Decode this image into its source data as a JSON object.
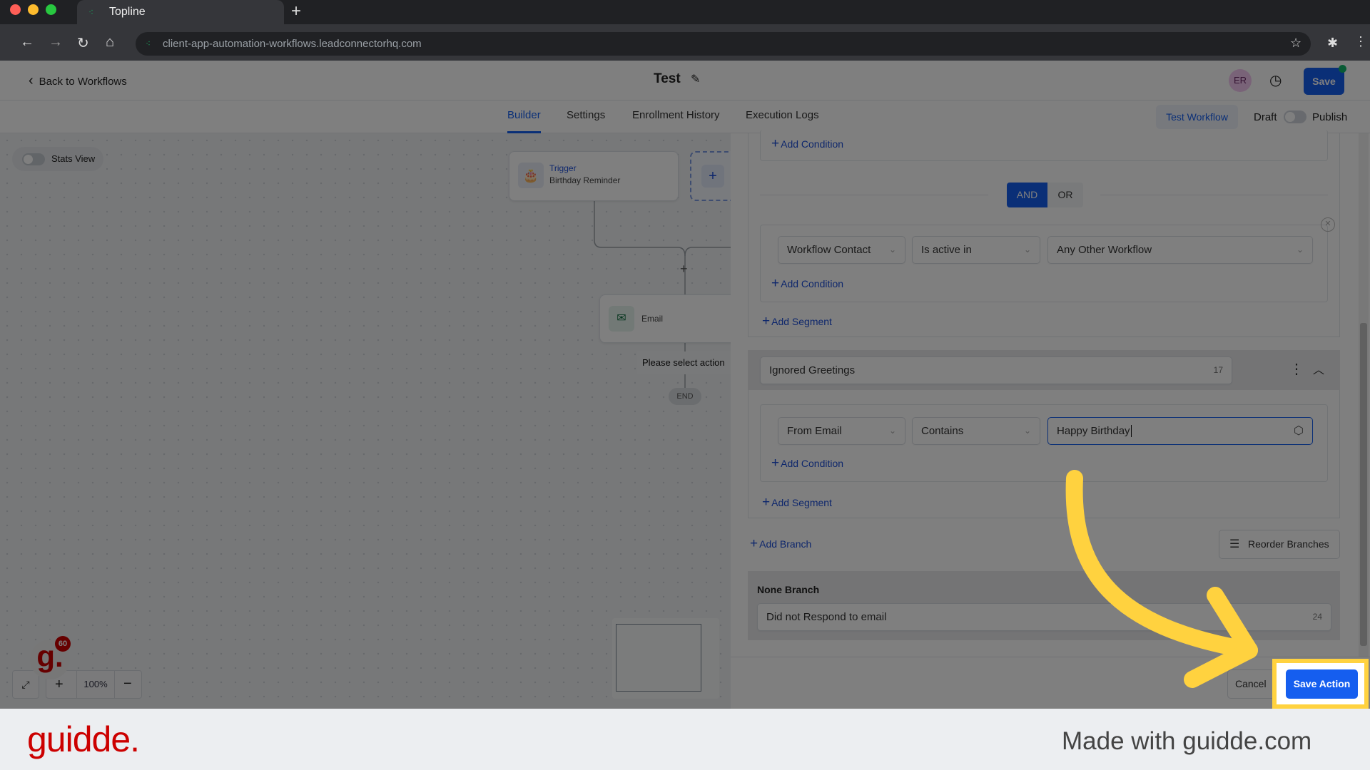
{
  "browser": {
    "tab_title": "Topline",
    "url": "client-app-automation-workflows.leadconnectorhq.com"
  },
  "header": {
    "back_label": "Back to Workflows",
    "title": "Test",
    "avatar_initials": "ER",
    "save_label": "Save"
  },
  "tabs": [
    {
      "label": "Builder",
      "active": true
    },
    {
      "label": "Settings"
    },
    {
      "label": "Enrollment History"
    },
    {
      "label": "Execution Logs"
    }
  ],
  "toolbar": {
    "test_workflow_label": "Test Workflow",
    "draft_label": "Draft",
    "publish_label": "Publish",
    "published": false
  },
  "canvas": {
    "stats_view_label": "Stats View",
    "stats_view_on": false,
    "trigger": {
      "label": "Trigger",
      "name": "Birthday Reminder"
    },
    "email_node": {
      "label": "Email"
    },
    "tooltip": "Please select action",
    "end_label": "END",
    "zoom_level": "100%"
  },
  "panel": {
    "add_condition": "Add Condition",
    "add_segment": "Add Segment",
    "logic": {
      "and": "AND",
      "or": "OR",
      "selected": "AND"
    },
    "segment1": {
      "field": "Workflow Contact",
      "operator": "Is active in",
      "value": "Any Other Workflow"
    },
    "branch": {
      "name": "Ignored Greetings",
      "char_count": "17",
      "condition": {
        "field": "From Email",
        "operator": "Contains",
        "value": "Happy Birthday"
      }
    },
    "add_branch": "Add Branch",
    "reorder_label": "Reorder Branches",
    "none_branch": {
      "title": "None Branch",
      "name": "Did not Respond to email",
      "char_count": "24"
    },
    "cancel_label": "Cancel",
    "save_action_label": "Save Action"
  },
  "guidde": {
    "logo": "guidde.",
    "badge": "60",
    "tagline": "Made with guidde.com"
  },
  "colors": {
    "primary": "#155eef",
    "highlight": "#ffd23f",
    "brand_red": "#cc0000"
  }
}
